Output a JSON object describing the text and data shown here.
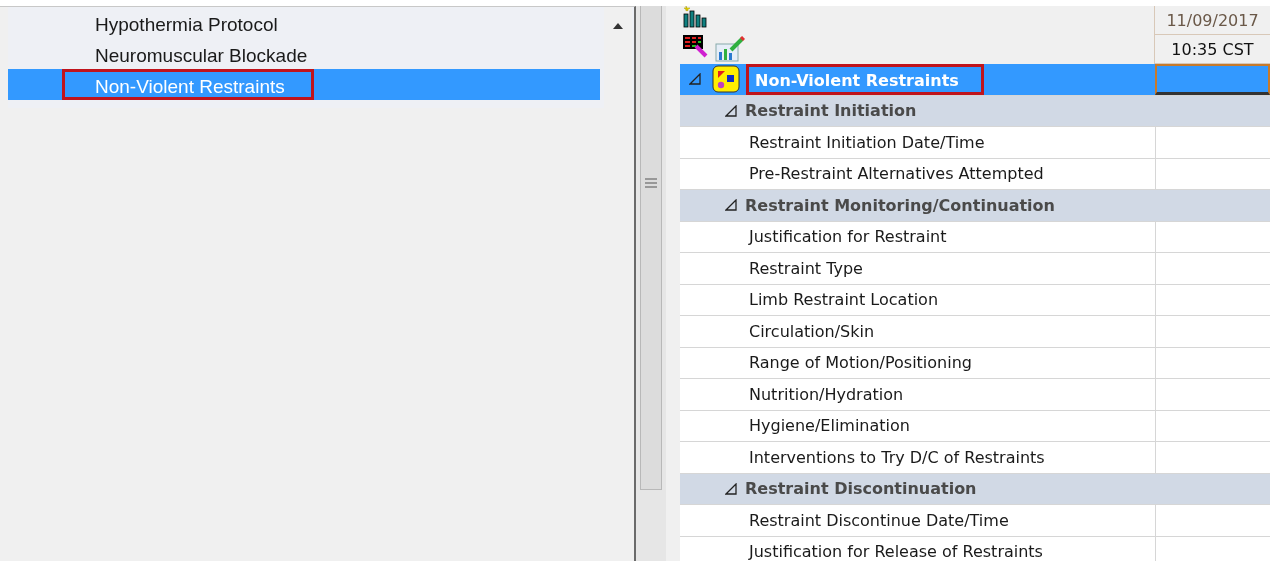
{
  "list": {
    "items": [
      {
        "label": "Hypothermia Protocol",
        "selected": false,
        "annotated": false
      },
      {
        "label": "Neuromuscular Blockade",
        "selected": false,
        "annotated": false
      },
      {
        "label": "Non-Violent Restraints",
        "selected": true,
        "annotated": true
      }
    ]
  },
  "grid": {
    "date": "11/09/2017",
    "time": "10:35 CST",
    "section": {
      "label": "Non-Violent Restraints",
      "selected": true,
      "annotated": true,
      "expanded": true,
      "children": [
        {
          "label": "Restraint Initiation",
          "expanded": true,
          "children": [
            {
              "label": "Restraint Initiation Date/Time"
            },
            {
              "label": "Pre-Restraint Alternatives Attempted"
            }
          ]
        },
        {
          "label": "Restraint Monitoring/Continuation",
          "expanded": true,
          "children": [
            {
              "label": "Justification for Restraint"
            },
            {
              "label": "Restraint Type"
            },
            {
              "label": "Limb Restraint Location"
            },
            {
              "label": "Circulation/Skin"
            },
            {
              "label": "Range of Motion/Positioning"
            },
            {
              "label": "Nutrition/Hydration"
            },
            {
              "label": "Hygiene/Elimination"
            },
            {
              "label": "Interventions to Try D/C of Restraints"
            }
          ]
        },
        {
          "label": "Restraint Discontinuation",
          "expanded": true,
          "children": [
            {
              "label": "Restraint Discontinue Date/Time"
            },
            {
              "label": "Justification for Release of Restraints"
            }
          ]
        }
      ]
    }
  }
}
